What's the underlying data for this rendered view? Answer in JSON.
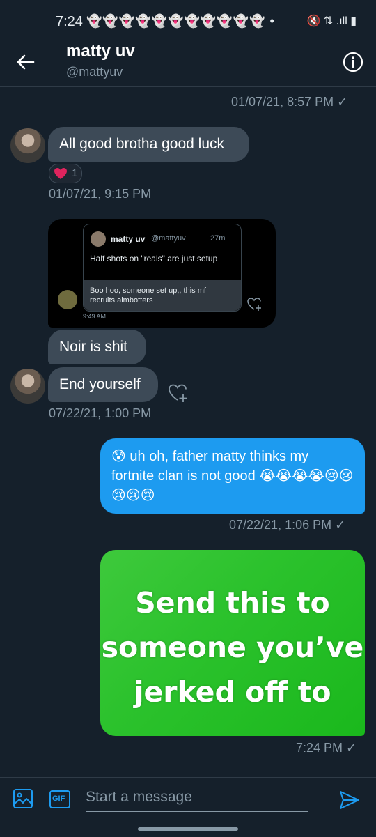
{
  "status_bar": {
    "time": "7:24",
    "notifications": "👻👻👻👻👻👻👻👻👻👻👻 •",
    "right_icons": "🔇 ⇅ .ıll ▮"
  },
  "header": {
    "name": "matty uv",
    "handle": "@mattyuv"
  },
  "messages": {
    "ts1": "01/07/21, 8:57 PM ✓",
    "m1": "All good brotha good luck",
    "reaction_count": "1",
    "ts2": "01/07/21, 9:15 PM",
    "tweet": {
      "author": "matty uv",
      "handle": "@mattyuv",
      "age": "27m",
      "text": "Half shots on \"reals\" are just setup",
      "reply": "Boo hoo, someone set up,, this mf recruits aimbotters",
      "time": "9:49 AM"
    },
    "m2": "Noir is shit",
    "m3": "End yourself",
    "ts3": "07/22/21, 1:00 PM",
    "out1": "😰 uh oh, father matty thinks my fortnite clan is not good 😭😭😭😭😢😢😢😢😢",
    "ts4": "07/22/21, 1:06 PM ✓",
    "image_caption": "Send this to someone you’ve jerked off to",
    "ts5": "7:24 PM ✓"
  },
  "composer": {
    "placeholder": "Start a message",
    "gif_label": "GIF"
  },
  "colors": {
    "background": "#15202b",
    "incoming_bubble": "#3d4a57",
    "outgoing_bubble": "#1d9bf0",
    "muted_text": "#8899a6",
    "reaction_heart": "#e0245e"
  }
}
